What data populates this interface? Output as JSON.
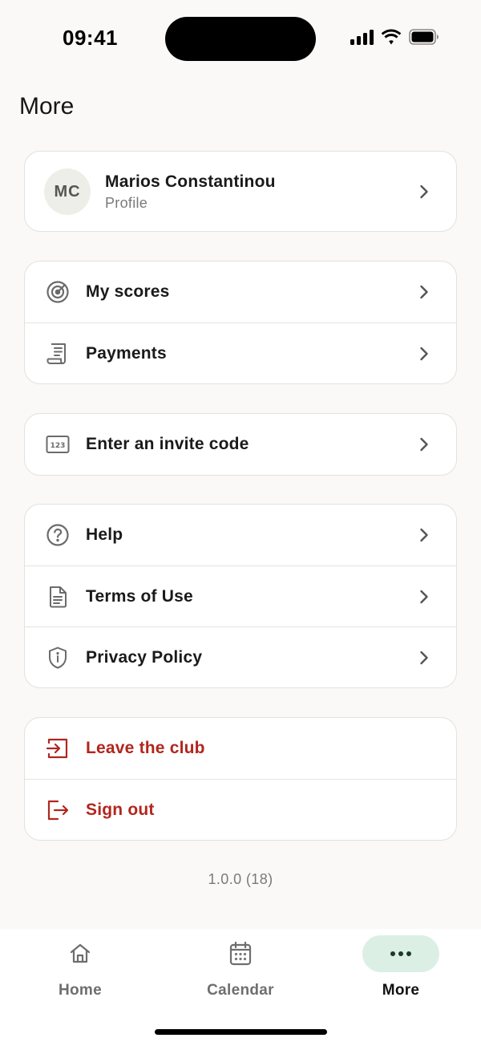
{
  "status_bar": {
    "time": "09:41"
  },
  "page": {
    "title": "More"
  },
  "profile": {
    "initials": "MC",
    "name": "Marios Constantinou",
    "subtitle": "Profile"
  },
  "groups": {
    "activity": [
      {
        "label": "My scores",
        "icon": "target-icon"
      },
      {
        "label": "Payments",
        "icon": "receipt-icon"
      }
    ],
    "invite": [
      {
        "label": "Enter an invite code",
        "icon": "numeric-keypad-icon"
      }
    ],
    "info": [
      {
        "label": "Help",
        "icon": "question-circle-icon"
      },
      {
        "label": "Terms of Use",
        "icon": "document-icon"
      },
      {
        "label": "Privacy Policy",
        "icon": "shield-icon"
      }
    ],
    "account": [
      {
        "label": "Leave the club",
        "icon": "exit-icon"
      },
      {
        "label": "Sign out",
        "icon": "sign-out-icon"
      }
    ]
  },
  "version": "1.0.0 (18)",
  "tabbar": {
    "home": "Home",
    "calendar": "Calendar",
    "more": "More",
    "active": "More"
  },
  "colors": {
    "background": "#faf9f7",
    "danger": "#b1261e",
    "active_tab_pill": "#dcefe4",
    "icon_gray": "#6b6b6b"
  }
}
